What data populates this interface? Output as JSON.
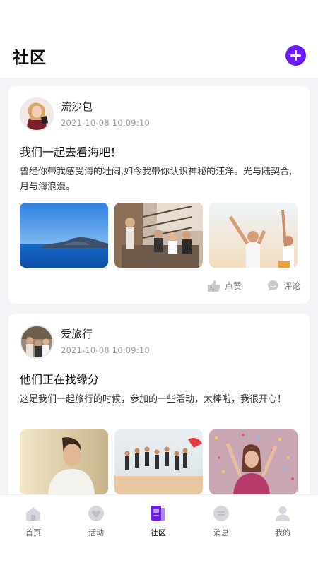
{
  "header": {
    "title": "社区",
    "add_icon": "plus-circle-icon",
    "accent": "#6b1cf5"
  },
  "posts": [
    {
      "author": "流沙包",
      "time": "2021-10-08  10:09:10",
      "title": "我们一起去看海吧！",
      "body": "曾经你带我感受海的壮阔,如今我带你认识神秘的汪洋。光与陆契合,月与海浪漫。",
      "photos": [
        "sea-cliff-photo",
        "friends-on-stairs-photo",
        "beach-party-photo"
      ],
      "like_label": "点赞",
      "comment_label": "评论"
    },
    {
      "author": "爱旅行",
      "time": "2021-10-08  10:09:10",
      "title": "他们正在找缘分",
      "body": "这是我们一起旅行的时候，参加的一些活动，太棒啦，我很开心！",
      "photos": [
        "man-smiling-photo",
        "group-jumping-beach-photo",
        "confetti-woman-photo"
      ]
    }
  ],
  "tabbar": {
    "items": [
      {
        "label": "首页",
        "icon": "home-icon"
      },
      {
        "label": "活动",
        "icon": "heart-icon"
      },
      {
        "label": "社区",
        "icon": "community-icon",
        "active": true
      },
      {
        "label": "消息",
        "icon": "message-icon"
      },
      {
        "label": "我的",
        "icon": "user-icon"
      }
    ]
  }
}
